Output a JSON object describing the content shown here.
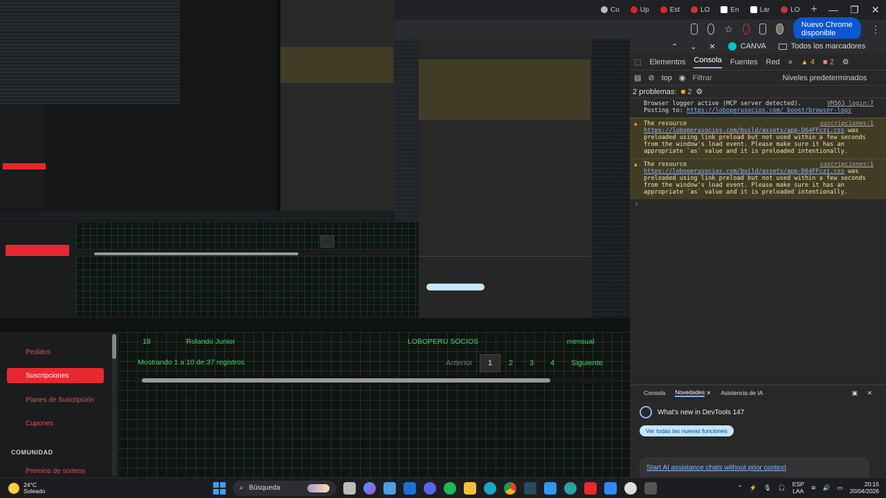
{
  "browser": {
    "tabs": [
      "Co",
      "Up",
      "Est",
      "LO",
      "En",
      "Lar",
      "LO"
    ],
    "new_tab": "+",
    "window_controls": [
      "—",
      "❐",
      "✕"
    ],
    "chrome_update_label": "Nuevo Chrome disponible",
    "bookmarks": [
      {
        "label": "CANVA",
        "icon": "canva-icon"
      },
      {
        "label": "Todos los marcadores",
        "icon": "folder-icon"
      }
    ]
  },
  "devtools": {
    "tabs": [
      "Elementos",
      "Consola",
      "Fuentes",
      "Red"
    ],
    "active_tab": "Consola",
    "warn_count": "4",
    "err_count": "2",
    "filter_context": "top",
    "filter_placeholder": "Filtrar",
    "levels_label": "Niveles predeterminados",
    "problems_label": "2 problemas:",
    "problems_count": "2",
    "logs": [
      {
        "type": "info",
        "text": "Browser logger active (MCP server detected). Posting to:",
        "link": "https://loboperusocios.com/_boost/browser-logs",
        "source": "VM563 login:7"
      },
      {
        "type": "warn",
        "text": "The resource",
        "link": "https://loboperusocios.com/build/assets/app-D64FFczi.css",
        "rest": "was preloaded using link preload but not used within a few seconds from the window's load event. Please make sure it has an appropriate `as` value and it is preloaded intentionally.",
        "source": "suscripciones:1"
      },
      {
        "type": "warn",
        "text": "The resource",
        "link": "https://loboperusocios.com/build/assets/app-D64FFczi.css",
        "rest": "was preloaded using link preload but not used within a few seconds from the window's load event. Please make sure it has an appropriate `as` value and it is preloaded intentionally.",
        "source": "suscripciones:1"
      }
    ],
    "prompt": "›",
    "drawer": {
      "tabs": [
        "Consola",
        "Novedades",
        "Asistencia de IA"
      ],
      "active_tab": "Novedades",
      "whats_new": "What's new in DevTools 147",
      "see_all": "Ver todas las nuevas funciones",
      "ai_link": "Start AI assistance chats without prior context"
    }
  },
  "sidebar": {
    "items": [
      {
        "label": "Pedidos",
        "active": false
      },
      {
        "label": "Suscripciones",
        "active": true
      },
      {
        "label": "Planes de Suscripción",
        "active": false
      },
      {
        "label": "Cupones",
        "active": false
      }
    ],
    "section": "COMUNIDAD",
    "partial_item": "Premios de sorteos"
  },
  "table": {
    "row": {
      "id": "18",
      "name": "Rolando Junior",
      "plan": "LOBOPERU SOCIOS",
      "period": "mensual"
    },
    "summary": "Mostrando 1 a 10 de 37 registros",
    "pager": {
      "prev": "Anterior",
      "pages": [
        "1",
        "2",
        "3",
        "4"
      ],
      "active_page": "1",
      "next": "Siguiente"
    }
  },
  "taskbar": {
    "weather_temp": "24°C",
    "weather_desc": "Soleado",
    "search_label": "Búsqueda",
    "lang_top": "ESP",
    "lang_bottom": "LAA",
    "time": "20:15",
    "date": "20/04/2026"
  }
}
